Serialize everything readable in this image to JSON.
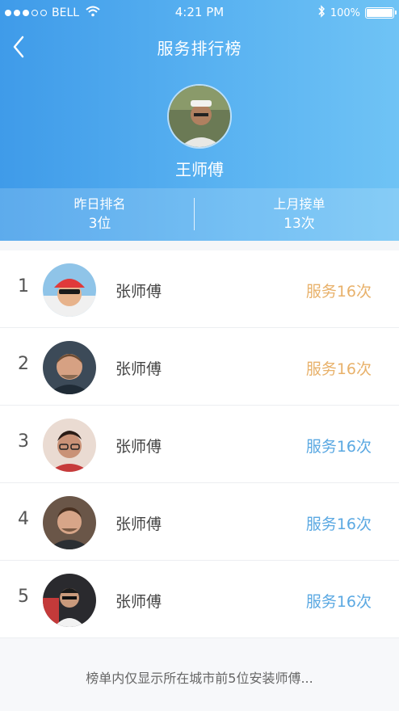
{
  "status_bar": {
    "carrier": "BELL",
    "time": "4:21 PM",
    "battery": "100%",
    "battery_level": 1.0
  },
  "nav": {
    "title": "服务排行榜",
    "back_icon": "chevron-left-icon"
  },
  "profile": {
    "name": "王师傅",
    "stats": [
      {
        "label": "昨日排名",
        "value": "3位"
      },
      {
        "label": "上月接单",
        "value": "13次"
      }
    ]
  },
  "ranking": [
    {
      "rank": "1",
      "name": "张师傅",
      "count": "服务16次",
      "highlight": "gold"
    },
    {
      "rank": "2",
      "name": "张师傅",
      "count": "服务16次",
      "highlight": "gold"
    },
    {
      "rank": "3",
      "name": "张师傅",
      "count": "服务16次",
      "highlight": "blue"
    },
    {
      "rank": "4",
      "name": "张师傅",
      "count": "服务16次",
      "highlight": "blue"
    },
    {
      "rank": "5",
      "name": "张师傅",
      "count": "服务16次",
      "highlight": "blue"
    }
  ],
  "footer": {
    "note": "榜单内仅显示所在城市前5位安装师傅..."
  },
  "colors": {
    "header_start": "#3f9be9",
    "header_end": "#6fc3f5",
    "gold": "#e8b16a",
    "blue": "#5aa8e2"
  }
}
